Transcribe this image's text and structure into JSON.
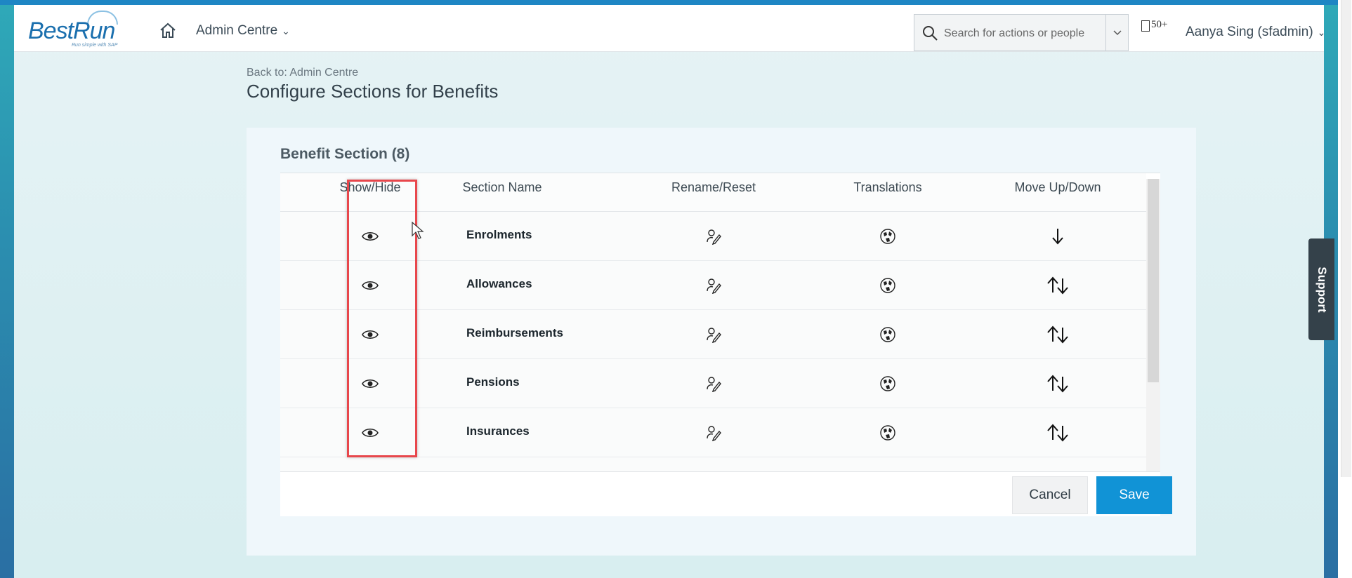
{
  "shell": {
    "logo_text": "BestRun",
    "logo_tagline": "Run simple with SAP",
    "module_label": "Admin Centre",
    "search_placeholder": "Search for actions or people",
    "notification_count": "50+",
    "user_label": "Aanya Sing (sfadmin)"
  },
  "page": {
    "back_link": "Back to: Admin Centre",
    "title": "Configure Sections for Benefits"
  },
  "panel": {
    "title": "Benefit Section (8)",
    "columns": {
      "show_hide": "Show/Hide",
      "section_name": "Section Name",
      "rename_reset": "Rename/Reset",
      "translations": "Translations",
      "move": "Move Up/Down"
    },
    "rows": [
      {
        "name": "Enrolments",
        "move": "down"
      },
      {
        "name": "Allowances",
        "move": "updown"
      },
      {
        "name": "Reimbursements",
        "move": "updown"
      },
      {
        "name": "Pensions",
        "move": "updown"
      },
      {
        "name": "Insurances",
        "move": "updown"
      }
    ],
    "buttons": {
      "cancel": "Cancel",
      "save": "Save"
    }
  },
  "support_label": "Support",
  "colors": {
    "accent": "#1193d6",
    "highlight": "#e8474c",
    "support_bg": "#34414a"
  },
  "icons": {
    "show_hide": "eye-icon",
    "rename": "edit-pencil-icon",
    "translations": "globe-icon",
    "move_down": "arrow-down-icon",
    "move_updown": "arrow-up-down-icon"
  }
}
